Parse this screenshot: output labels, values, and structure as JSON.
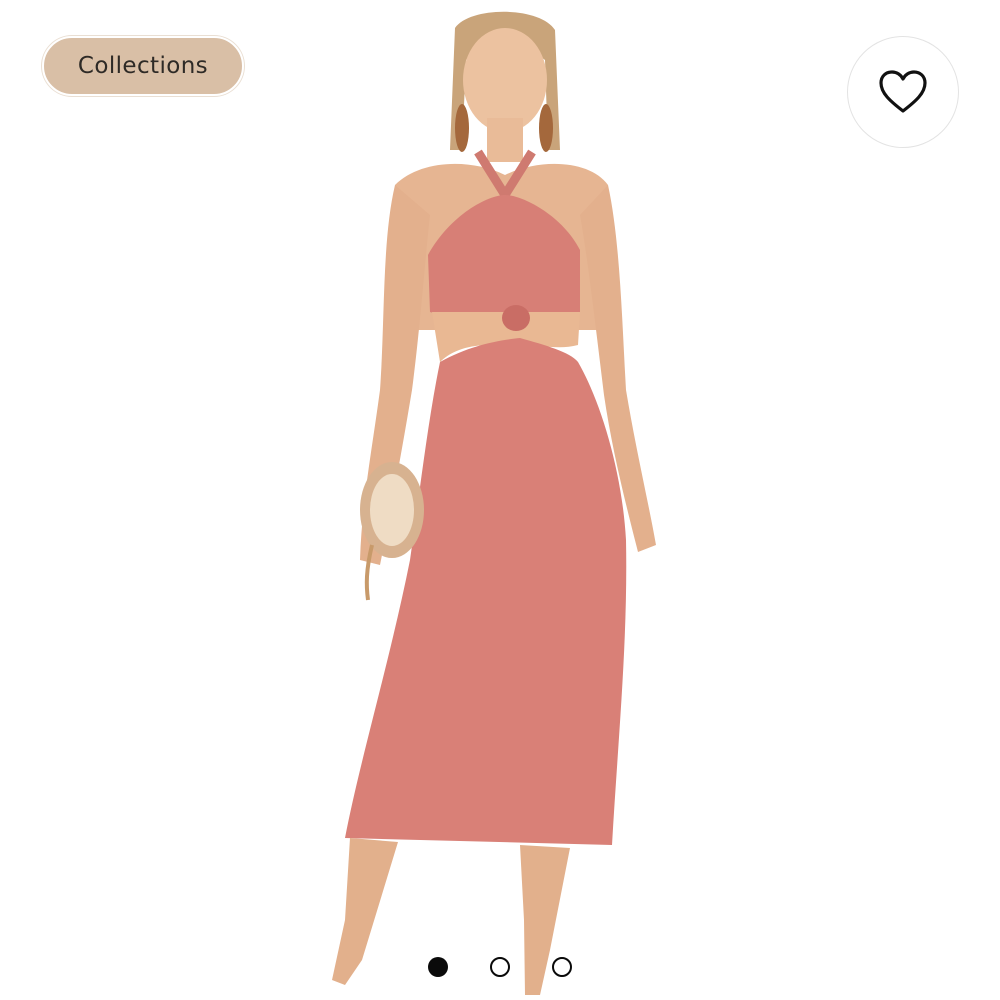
{
  "header": {
    "collections_label": "Collections",
    "favorite_icon": "heart-outline-icon"
  },
  "product": {
    "image_subject": "woman-in-rose-knit-halter-cutout-midi-dress",
    "dress_color": "#d97f76",
    "chip_color": "#d9bfa6"
  },
  "carousel": {
    "pages": 3,
    "active_index": 0
  }
}
